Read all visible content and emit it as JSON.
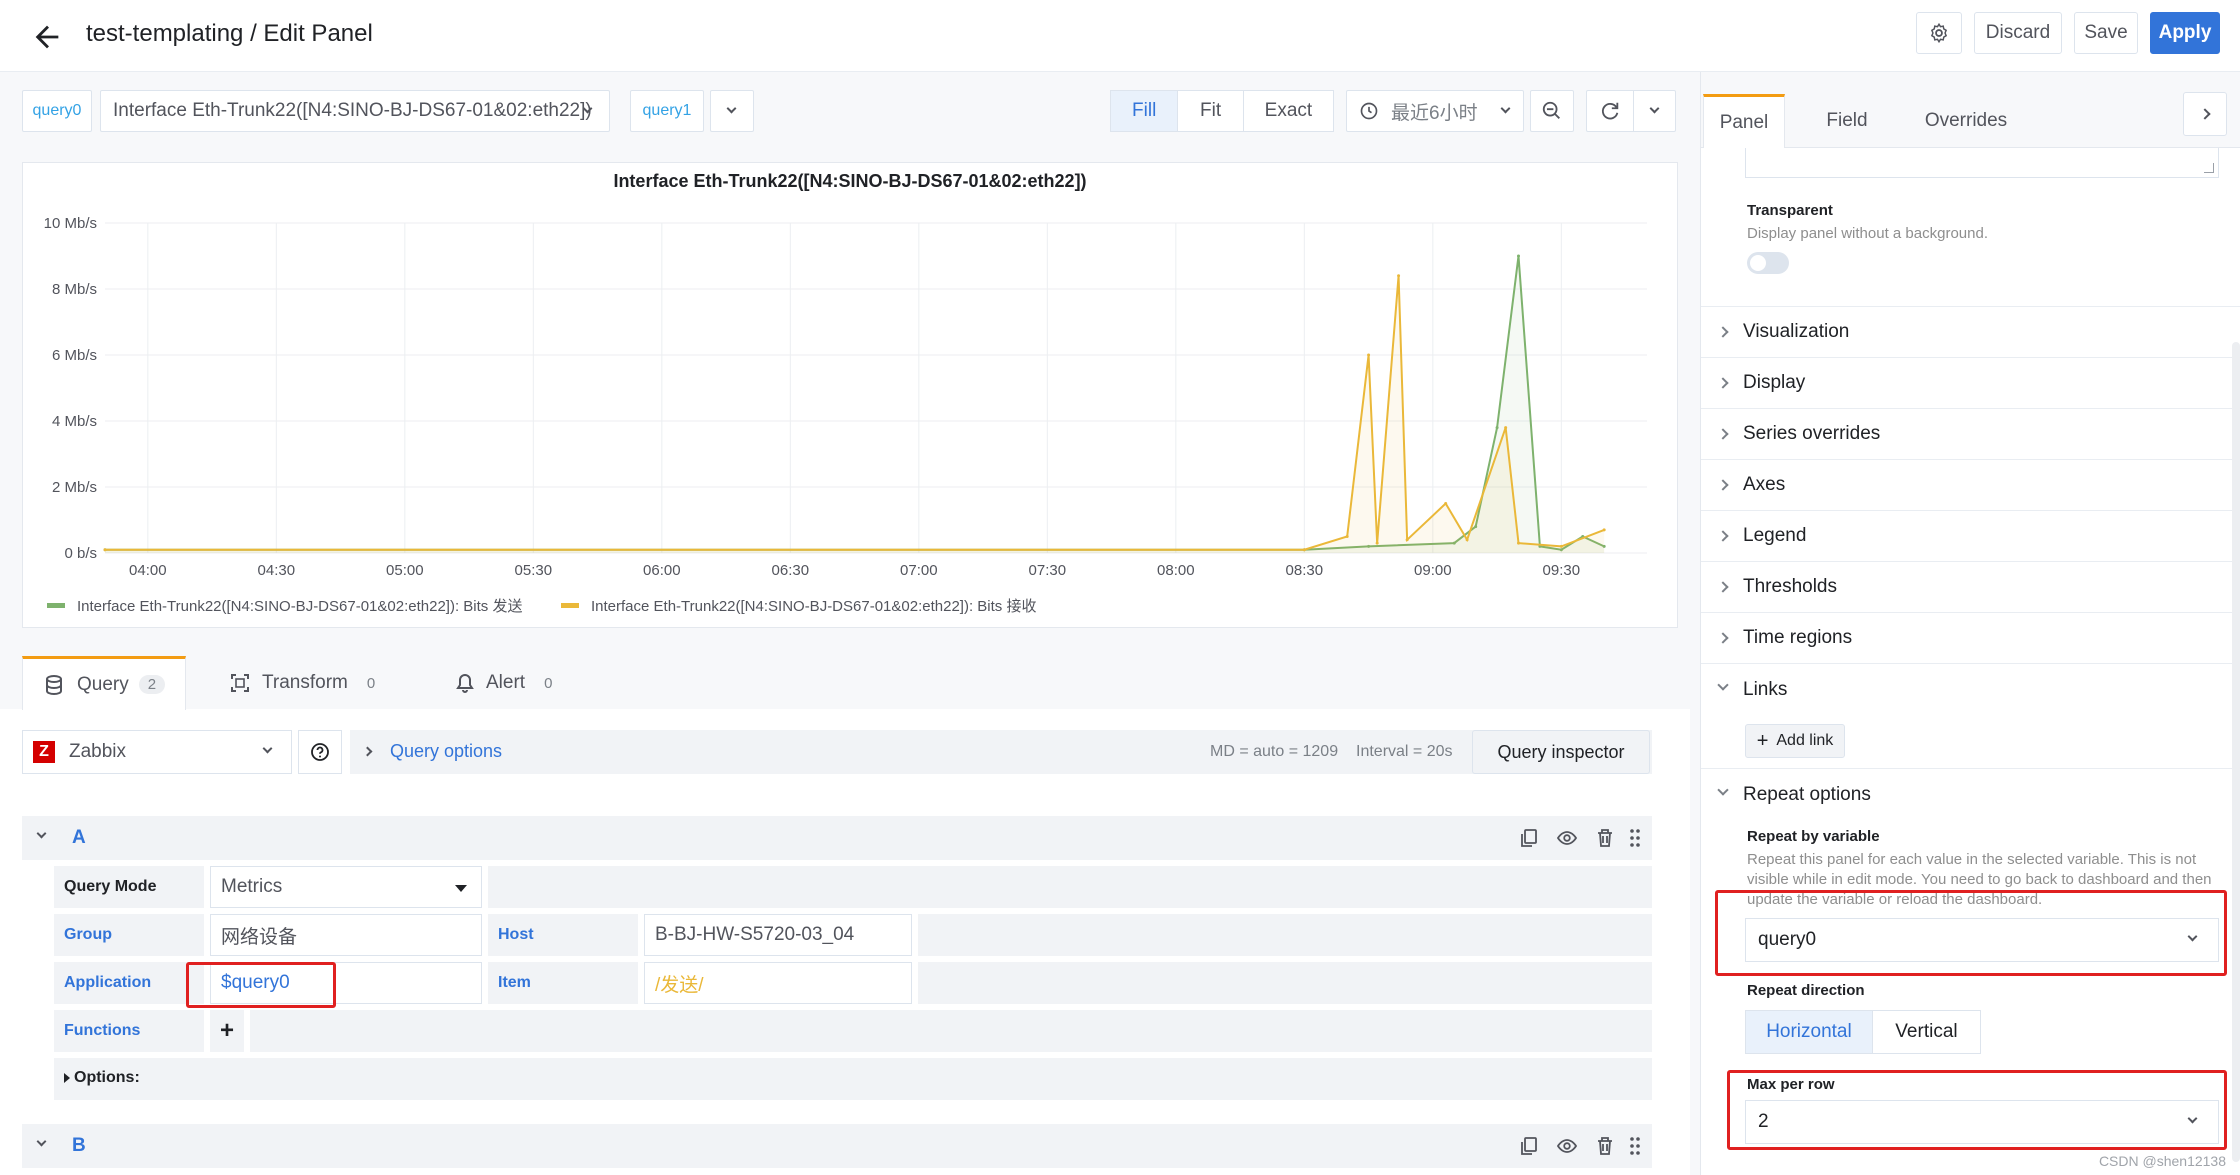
{
  "header": {
    "title": "test-templating / Edit Panel",
    "discard_label": "Discard",
    "save_label": "Save",
    "apply_label": "Apply"
  },
  "variables": {
    "query0_label": "query0",
    "query0_value": "Interface Eth-Trunk22([N4:SINO-BJ-DS67-01&02:eth22])",
    "query1_label": "query1"
  },
  "view_modes": {
    "fill": "Fill",
    "fit": "Fit",
    "exact": "Exact"
  },
  "time_picker": {
    "range": "最近6小时"
  },
  "panel": {
    "title": "Interface Eth-Trunk22([N4:SINO-BJ-DS67-01&02:eth22])"
  },
  "chart_data": {
    "type": "line",
    "title": "Interface Eth-Trunk22([N4:SINO-BJ-DS67-01&02:eth22])",
    "x_ticks": [
      "04:00",
      "04:30",
      "05:00",
      "05:30",
      "06:00",
      "06:30",
      "07:00",
      "07:30",
      "08:00",
      "08:30",
      "09:00",
      "09:30"
    ],
    "y_ticks": [
      "10 Mb/s",
      "8 Mb/s",
      "6 Mb/s",
      "4 Mb/s",
      "2 Mb/s",
      "0 b/s"
    ],
    "y_values": [
      10,
      8,
      6,
      4,
      2,
      0
    ],
    "ylim": [
      0,
      10
    ],
    "grid": true,
    "legend_position": "bottom-left",
    "series": [
      {
        "name": "Interface Eth-Trunk22([N4:SINO-BJ-DS67-01&02:eth22]): Bits 发送",
        "color": "#7eb26d",
        "points": [
          [
            "03:50",
            0.1
          ],
          [
            "08:30",
            0.1
          ],
          [
            "08:45",
            0.2
          ],
          [
            "09:05",
            0.3
          ],
          [
            "09:10",
            0.8
          ],
          [
            "09:15",
            3.8
          ],
          [
            "09:20",
            9.0
          ],
          [
            "09:25",
            0.2
          ],
          [
            "09:30",
            0.1
          ],
          [
            "09:35",
            0.5
          ],
          [
            "09:40",
            0.2
          ]
        ]
      },
      {
        "name": "Interface Eth-Trunk22([N4:SINO-BJ-DS67-01&02:eth22]): Bits 接收",
        "color": "#eab839",
        "points": [
          [
            "03:50",
            0.1
          ],
          [
            "08:30",
            0.1
          ],
          [
            "08:40",
            0.5
          ],
          [
            "08:45",
            6.0
          ],
          [
            "08:47",
            0.3
          ],
          [
            "08:52",
            8.4
          ],
          [
            "08:54",
            0.4
          ],
          [
            "09:03",
            1.5
          ],
          [
            "09:08",
            0.4
          ],
          [
            "09:17",
            3.8
          ],
          [
            "09:20",
            0.3
          ],
          [
            "09:30",
            0.2
          ],
          [
            "09:40",
            0.7
          ]
        ]
      }
    ]
  },
  "query_tabs": [
    {
      "label": "Query",
      "count": "2"
    },
    {
      "label": "Transform",
      "count": "0"
    },
    {
      "label": "Alert",
      "count": "0"
    }
  ],
  "datasource": {
    "name": "Zabbix"
  },
  "query_options": {
    "label": "Query options",
    "md": "MD = auto = 1209",
    "interval": "Interval = 20s",
    "inspector_label": "Query inspector"
  },
  "query_a": {
    "letter": "A",
    "query_mode_label": "Query Mode",
    "query_mode_value": "Metrics",
    "group_label": "Group",
    "group_value": "网络设备",
    "host_label": "Host",
    "host_value": "B-BJ-HW-S5720-03_04",
    "application_label": "Application",
    "application_value": "$query0",
    "item_label": "Item",
    "item_value": "/发送/",
    "functions_label": "Functions",
    "options_label": "Options:"
  },
  "query_b": {
    "letter": "B"
  },
  "options_pane": {
    "tabs": [
      "Panel",
      "Field",
      "Overrides"
    ],
    "transparent_label": "Transparent",
    "transparent_desc": "Display panel without a background.",
    "transparent_on": false,
    "sections": [
      "Visualization",
      "Display",
      "Series overrides",
      "Axes",
      "Legend",
      "Thresholds",
      "Time regions",
      "Links"
    ],
    "add_link_label": "Add link",
    "repeat_options_label": "Repeat options",
    "repeat_by_label": "Repeat by variable",
    "repeat_by_desc": "Repeat this panel for each value in the selected variable. This is not visible while in edit mode. You need to go back to dashboard and then update the variable or reload the dashboard.",
    "repeat_by_value": "query0",
    "repeat_direction_label": "Repeat direction",
    "direction_horizontal": "Horizontal",
    "direction_vertical": "Vertical",
    "max_per_row_label": "Max per row",
    "max_per_row_value": "2"
  },
  "watermark": "CSDN @shen12138"
}
